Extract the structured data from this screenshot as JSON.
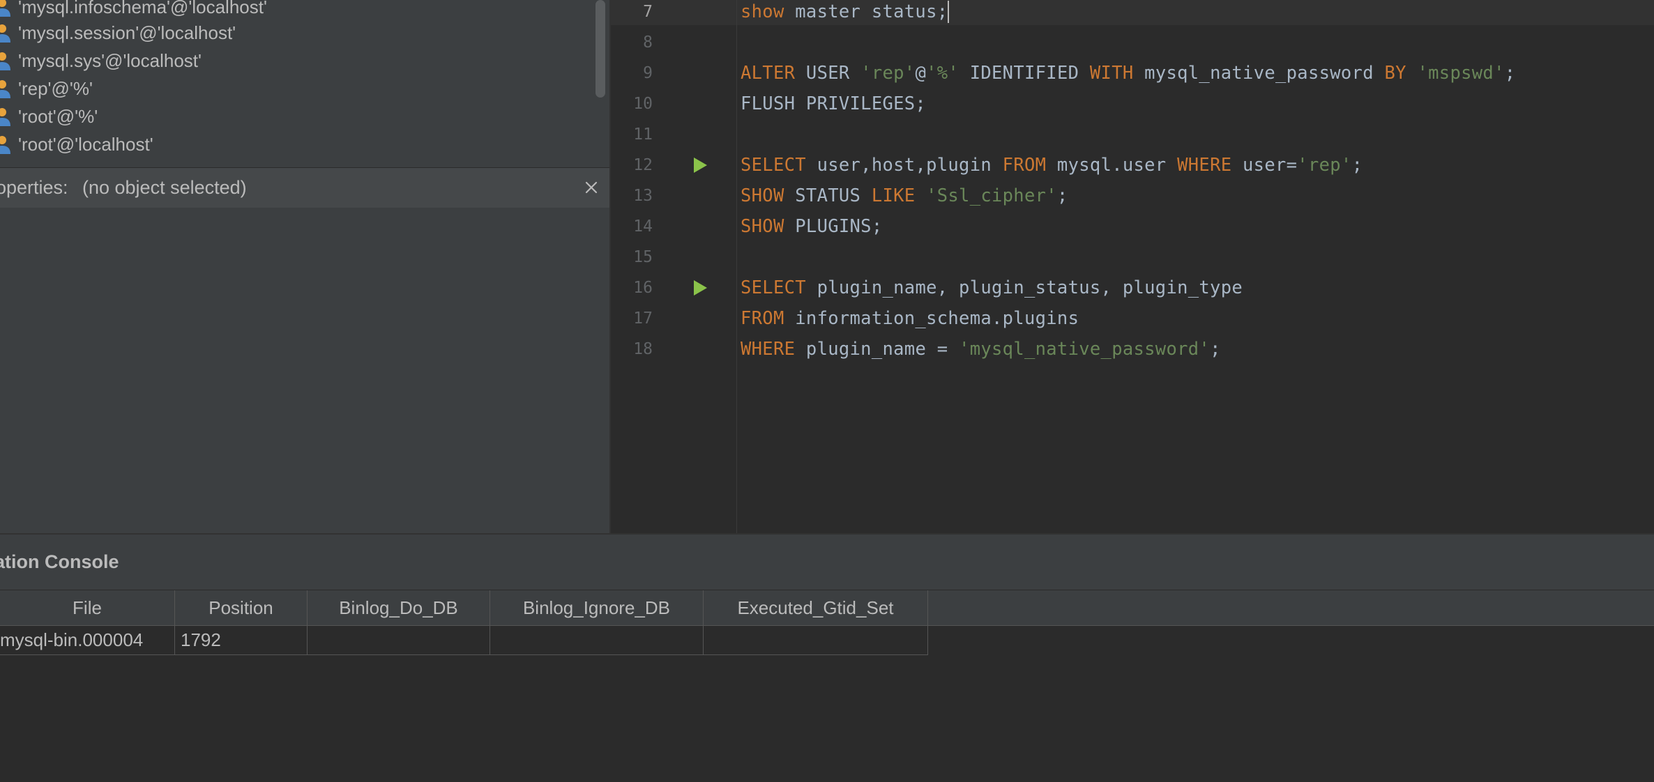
{
  "tree": {
    "items": [
      {
        "label": "'mysql.infoschema'@'localhost'",
        "icon": "user-icon"
      },
      {
        "label": "'mysql.session'@'localhost'",
        "icon": "user-icon"
      },
      {
        "label": "'mysql.sys'@'localhost'",
        "icon": "user-icon"
      },
      {
        "label": "'rep'@'%'",
        "icon": "user-icon"
      },
      {
        "label": "'root'@'%'",
        "icon": "user-icon"
      },
      {
        "label": "'root'@'localhost'",
        "icon": "user-icon"
      }
    ]
  },
  "properties": {
    "label": "operties:",
    "value": "(no object selected)"
  },
  "editor": {
    "line_numbers": [
      "7",
      "8",
      "9",
      "10",
      "11",
      "12",
      "13",
      "14",
      "15",
      "16",
      "17",
      "18"
    ],
    "lines": {
      "l7": [
        {
          "t": "show",
          "c": "kw"
        },
        {
          "t": " master status;",
          "c": "plain"
        }
      ],
      "l9": [
        {
          "t": "ALTER",
          "c": "kw"
        },
        {
          "t": " USER ",
          "c": "plain"
        },
        {
          "t": "'rep'",
          "c": "str"
        },
        {
          "t": "@",
          "c": "plain"
        },
        {
          "t": "'%'",
          "c": "str"
        },
        {
          "t": " IDENTIFIED ",
          "c": "plain"
        },
        {
          "t": "WITH",
          "c": "kw"
        },
        {
          "t": " mysql_native_password ",
          "c": "plain"
        },
        {
          "t": "BY",
          "c": "kw"
        },
        {
          "t": " ",
          "c": "plain"
        },
        {
          "t": "'mspswd'",
          "c": "str"
        },
        {
          "t": ";",
          "c": "plain"
        }
      ],
      "l10": [
        {
          "t": "FLUSH PRIVILEGES;",
          "c": "plain"
        }
      ],
      "l12": [
        {
          "t": "SELECT",
          "c": "kw"
        },
        {
          "t": " user,host,plugin ",
          "c": "plain"
        },
        {
          "t": "FROM",
          "c": "kw"
        },
        {
          "t": " mysql.user ",
          "c": "plain"
        },
        {
          "t": "WHERE",
          "c": "kw"
        },
        {
          "t": " user=",
          "c": "plain"
        },
        {
          "t": "'rep'",
          "c": "str"
        },
        {
          "t": ";",
          "c": "plain"
        }
      ],
      "l13": [
        {
          "t": "SHOW",
          "c": "kw"
        },
        {
          "t": " STATUS ",
          "c": "plain"
        },
        {
          "t": "LIKE",
          "c": "kw"
        },
        {
          "t": " ",
          "c": "plain"
        },
        {
          "t": "'Ssl_cipher'",
          "c": "str"
        },
        {
          "t": ";",
          "c": "plain"
        }
      ],
      "l14": [
        {
          "t": "SHOW",
          "c": "kw"
        },
        {
          "t": " PLUGINS;",
          "c": "plain"
        }
      ],
      "l16": [
        {
          "t": "SELECT",
          "c": "kw"
        },
        {
          "t": " plugin_name, plugin_status, plugin_type",
          "c": "plain"
        }
      ],
      "l17": [
        {
          "t": "FROM",
          "c": "kw"
        },
        {
          "t": " information_schema.plugins",
          "c": "plain"
        }
      ],
      "l18": [
        {
          "t": "WHERE",
          "c": "kw"
        },
        {
          "t": " plugin_name = ",
          "c": "plain"
        },
        {
          "t": "'mysql_native_password'",
          "c": "str"
        },
        {
          "t": ";",
          "c": "plain"
        }
      ]
    },
    "run_icon": "run-triangle-icon"
  },
  "console": {
    "title": "ation Console",
    "columns": [
      "File",
      "Position",
      "Binlog_Do_DB",
      "Binlog_Ignore_DB",
      "Executed_Gtid_Set"
    ],
    "rows": [
      [
        "mysql-bin.000004",
        "1792",
        "",
        "",
        ""
      ]
    ]
  },
  "colors": {
    "keyword": "#cc7832",
    "string": "#6a8759",
    "identifier": "#a9b7c6",
    "run_icon": "#8bc34a",
    "user_icon_head": "#e8a33c",
    "user_icon_body": "#4a86c8"
  }
}
